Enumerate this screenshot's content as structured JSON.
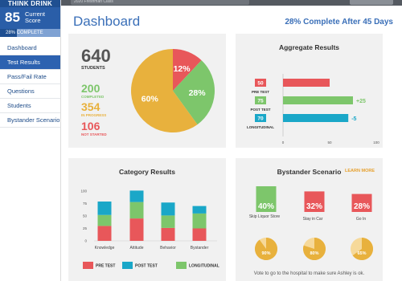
{
  "sidebar": {
    "brand": "THINK DRINK",
    "score": "85",
    "score_label": "Current Score",
    "progress_percent": 28,
    "progress_text": "28% COMPLETE",
    "items": [
      {
        "label": "Dashboard",
        "active": false
      },
      {
        "label": "Test Results",
        "active": true
      },
      {
        "label": "Pass/Fail Rate",
        "active": false
      },
      {
        "label": "Questions",
        "active": false
      },
      {
        "label": "Students",
        "active": false
      },
      {
        "label": "Bystander Scenario",
        "active": false
      }
    ]
  },
  "topbar": {
    "input_value": "2020 Freshman Class"
  },
  "header": {
    "title": "Dashboard",
    "status": "28% Complete After 45 Days"
  },
  "overview": {
    "students": {
      "value": "640",
      "label": "STUDENTS",
      "color": "#555555"
    },
    "completed": {
      "value": "200",
      "label": "COMPLETED",
      "color": "#7dc66b"
    },
    "in_progress": {
      "value": "354",
      "label": "IN PROGRESS",
      "color": "#e8b13d"
    },
    "not_started": {
      "value": "106",
      "label": "NOT STARTED",
      "color": "#e8575a"
    },
    "pie": [
      {
        "label": "12%",
        "value": 12,
        "color": "#e8575a"
      },
      {
        "label": "28%",
        "value": 28,
        "color": "#7dc66b"
      },
      {
        "label": "60%",
        "value": 60,
        "color": "#e8b13d"
      }
    ]
  },
  "aggregate": {
    "title": "Aggregate Results",
    "rows": [
      {
        "value": 50,
        "label": "PRE TEST",
        "color": "#e8575a",
        "delta": ""
      },
      {
        "value": 75,
        "label": "POST TEST",
        "color": "#7dc66b",
        "delta": "+25"
      },
      {
        "value": 70,
        "label": "LONGITUDINAL",
        "color": "#1aa7c8",
        "delta": "-5"
      }
    ],
    "ticks": [
      "0",
      "50",
      "100"
    ],
    "xlim": [
      0,
      100
    ]
  },
  "category": {
    "title": "Category Results",
    "legend": [
      {
        "label": "PRE TEST",
        "color": "#e8575a"
      },
      {
        "label": "POST TEST",
        "color": "#1aa7c8"
      },
      {
        "label": "LONGITUDINAL",
        "color": "#7dc66b"
      }
    ]
  },
  "bystander": {
    "title": "Bystander Scenario",
    "learn_more": "LEARN MORE",
    "options": [
      {
        "label": "Skip Liquor Store",
        "percent": 40,
        "text": "40%",
        "color": "#7dc66b"
      },
      {
        "label": "Stay in Car",
        "percent": 32,
        "text": "32%",
        "color": "#e8575a"
      },
      {
        "label": "Go In",
        "percent": 28,
        "text": "28%",
        "color": "#e8575a"
      }
    ],
    "hospital": [
      {
        "percent": 90,
        "text": "90%"
      },
      {
        "percent": 80,
        "text": "80%"
      },
      {
        "percent": 65,
        "text": "65%"
      }
    ],
    "caption": "Vote to go to the hospital to make sure Ashley is ok."
  },
  "chart_data": {
    "type": "bar",
    "title": "Category Results",
    "categories": [
      "Knowledge",
      "Attitude",
      "Behavior",
      "Bystander"
    ],
    "series": [
      {
        "name": "PRE TEST",
        "values": [
          30,
          45,
          26,
          25
        ]
      },
      {
        "name": "LONGITUDINAL",
        "values": [
          22,
          33,
          25,
          30
        ]
      },
      {
        "name": "POST TEST",
        "values": [
          27,
          23,
          26,
          15
        ]
      }
    ],
    "stacked": true,
    "yticks": [
      "100",
      "75",
      "50",
      "25",
      "0"
    ],
    "ylim": [
      0,
      100
    ],
    "grid": false,
    "legend_position": "bottom"
  }
}
